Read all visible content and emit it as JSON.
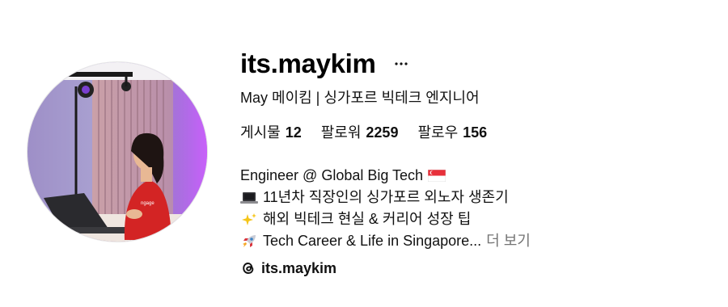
{
  "profile": {
    "username": "its.maykim",
    "full_name": "May 메이킴 | 싱가포르 빅테크 엔지니어",
    "more_icon": "ellipsis-icon",
    "avatar_icon": "profile-photo"
  },
  "stats": {
    "posts_label": "게시물",
    "posts_count": "12",
    "followers_label": "팔로워",
    "followers_count": "2259",
    "following_label": "팔로우",
    "following_count": "156"
  },
  "bio": {
    "line1": "Engineer @ Global Big Tech",
    "line1_emoji": "singapore-flag-icon",
    "line2": "11년차 직장인의 싱가포르 외노자 생존기",
    "line2_emoji": "laptop-icon",
    "line3": "해외 빅테크 현실 & 커리어 성장 팁",
    "line3_emoji": "sparkles-icon",
    "line4": "Tech Career & Life in Singapore...",
    "line4_emoji": "rocket-icon",
    "see_more": "더 보기"
  },
  "threads": {
    "icon": "threads-icon",
    "handle": "its.maykim"
  }
}
